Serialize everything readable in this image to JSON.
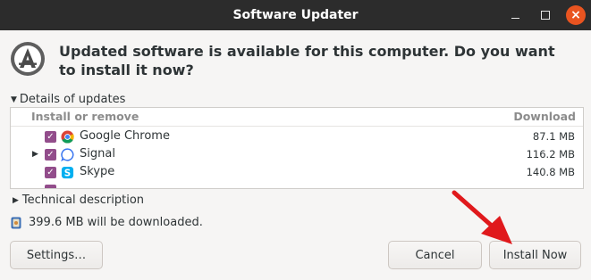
{
  "window": {
    "title": "Software Updater",
    "controls": [
      "minimize-icon",
      "maximize-icon",
      "close-icon"
    ]
  },
  "headline": "Updated software is available for this computer. Do you want to install it now?",
  "details": {
    "label": "Details of updates",
    "columns": {
      "install": "Install or remove",
      "download": "Download"
    },
    "rows": [
      {
        "name": "Google Chrome",
        "size": "87.1 MB",
        "checked": true,
        "icon": "chrome-icon",
        "expandable": false
      },
      {
        "name": "Signal",
        "size": "116.2 MB",
        "checked": true,
        "icon": "signal-icon",
        "expandable": true
      },
      {
        "name": "Skype",
        "size": "140.8 MB",
        "checked": true,
        "icon": "skype-icon",
        "expandable": false
      }
    ]
  },
  "technical": {
    "label": "Technical description"
  },
  "download_summary": "399.6 MB will be downloaded.",
  "buttons": {
    "settings": "Settings…",
    "cancel": "Cancel",
    "install": "Install Now"
  },
  "colors": {
    "titlebar": "#2c2c2c",
    "close": "#e95420",
    "checkbox": "#924d8b",
    "arrow": "#e0191c"
  }
}
